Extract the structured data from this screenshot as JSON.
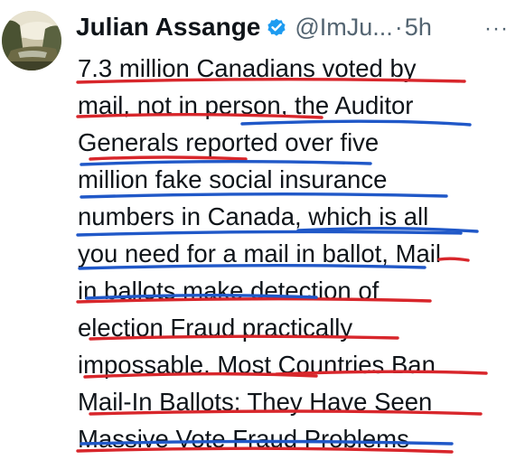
{
  "tweet": {
    "author_name": "Julian Assange",
    "handle": "@ImJu...",
    "separator": "·",
    "time": "5h",
    "more_label": "···",
    "verified_color": "#1d9bf0",
    "icons": {
      "avatar": "landscape-painting-avatar",
      "verified": "verified-badge-icon",
      "more": "more-options-icon"
    },
    "lines": [
      "7.3 million Canadians voted by",
      "mail, not in person, the Auditor",
      "Generals reported over five",
      "million fake social insurance",
      "numbers in Canada, which is all",
      "you need for a mail in ballot, Mail",
      "in ballots make detection of",
      "election Fraud practically",
      "impossable. Most Countries Ban",
      "Mail-In Ballots: They Have Seen",
      "Massive Vote Fraud Problems"
    ],
    "annotation_colors": {
      "red": "#d8262b",
      "blue": "#2058c8"
    }
  }
}
